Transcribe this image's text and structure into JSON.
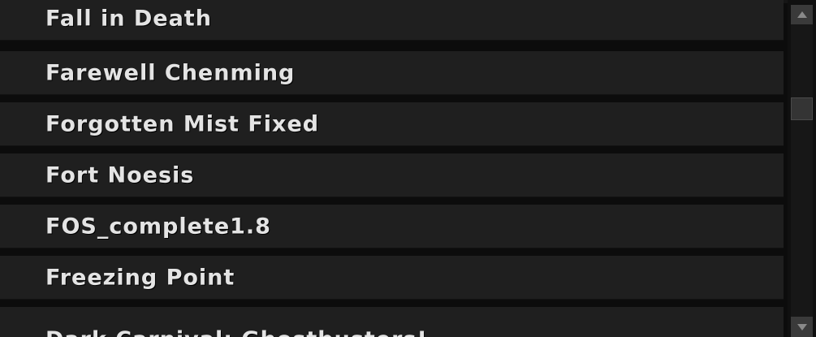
{
  "level_list": {
    "items": [
      {
        "label": "Fall in Death"
      },
      {
        "label": "Farewell Chenming"
      },
      {
        "label": "Forgotten Mist Fixed"
      },
      {
        "label": "Fort Noesis"
      },
      {
        "label": "FOS_complete1.8"
      },
      {
        "label": "Freezing Point"
      },
      {
        "label": "Dark Carnival: Ghostbusters!"
      }
    ]
  },
  "scrollbar": {
    "up_icon": "triangle-up-icon",
    "down_icon": "triangle-down-icon",
    "position_fraction": 0.27
  },
  "colors": {
    "row_background": "#1f1f1f",
    "text": "#e4e4e4",
    "background": "#0c0c0c"
  }
}
